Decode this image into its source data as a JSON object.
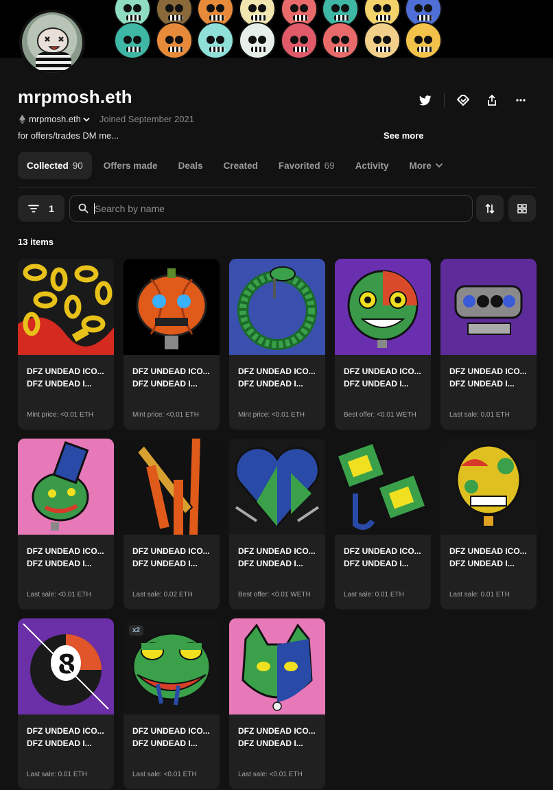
{
  "banner": {
    "skull_colors": [
      "#8fdcc0",
      "#8a6a3a",
      "#e78a3a",
      "#f2e6b0",
      "#e96a6a",
      "#3fb7a5",
      "#f3d36a",
      "#4f6fd6",
      "#3fb7a5",
      "#e78a3a",
      "#8fe0d8",
      "#e6f0e8",
      "#e05a6a",
      "#e96a6a",
      "#f2d08a",
      "#f3c24a"
    ]
  },
  "profile": {
    "name": "mrpmosh.eth",
    "wallet": "mrpmosh.eth",
    "joined": "Joined September 2021",
    "bio": "for offers/trades DM me...",
    "see_more": "See more"
  },
  "actions": [
    "twitter-icon",
    "offers-icon",
    "share-icon",
    "more-icon"
  ],
  "tabs": [
    {
      "label": "Collected",
      "count": "90",
      "active": true
    },
    {
      "label": "Offers made",
      "count": ""
    },
    {
      "label": "Deals",
      "count": ""
    },
    {
      "label": "Created",
      "count": ""
    },
    {
      "label": "Favorited",
      "count": "69"
    },
    {
      "label": "Activity",
      "count": ""
    },
    {
      "label": "More",
      "count": ""
    }
  ],
  "filter": {
    "count": "1"
  },
  "search": {
    "placeholder": "Search by name"
  },
  "items_count": "13 items",
  "items": [
    {
      "title": "DFZ UNDEAD ICO...",
      "subtitle": "DFZ UNDEAD I...",
      "price": "Mint price: <0.01 ETH",
      "bg": "#1a1a1a",
      "art": "chains"
    },
    {
      "title": "DFZ UNDEAD ICO...",
      "subtitle": "DFZ UNDEAD I...",
      "price": "Mint price: <0.01 ETH",
      "bg": "#000000",
      "art": "pumpkin"
    },
    {
      "title": "DFZ UNDEAD ICO...",
      "subtitle": "DFZ UNDEAD I...",
      "price": "Mint price: <0.01 ETH",
      "bg": "#3a4fae",
      "art": "snake"
    },
    {
      "title": "DFZ UNDEAD ICO...",
      "subtitle": "DFZ UNDEAD I...",
      "price": "Best offer: <0.01 WETH",
      "bg": "#6a2fae",
      "art": "zombie"
    },
    {
      "title": "DFZ UNDEAD ICO...",
      "subtitle": "DFZ UNDEAD I...",
      "price": "Last sale: 0.01 ETH",
      "bg": "#5e2b9a",
      "art": "knuckles"
    },
    {
      "title": "DFZ UNDEAD ICO...",
      "subtitle": "DFZ UNDEAD I...",
      "price": "Last sale: <0.01 ETH",
      "bg": "#e879b8",
      "art": "mouse"
    },
    {
      "title": "DFZ UNDEAD ICO...",
      "subtitle": "DFZ UNDEAD I...",
      "price": "Last sale: 0.02 ETH",
      "bg": "#111111",
      "art": "dagger"
    },
    {
      "title": "DFZ UNDEAD ICO...",
      "subtitle": "DFZ UNDEAD I...",
      "price": "Best offer: <0.01 WETH",
      "bg": "#181818",
      "art": "heart"
    },
    {
      "title": "DFZ UNDEAD ICO...",
      "subtitle": "DFZ UNDEAD I...",
      "price": "Last sale: 0.01 ETH",
      "bg": "#121212",
      "art": "glasses"
    },
    {
      "title": "DFZ UNDEAD ICO...",
      "subtitle": "DFZ UNDEAD I...",
      "price": "Last sale: 0.01 ETH",
      "bg": "#151515",
      "art": "balloon"
    },
    {
      "title": "DFZ UNDEAD ICO...",
      "subtitle": "DFZ UNDEAD I...",
      "price": "Last sale: 0.01 ETH",
      "bg": "#6b2fa8",
      "art": "eightball"
    },
    {
      "title": "DFZ UNDEAD ICO...",
      "subtitle": "DFZ UNDEAD I...",
      "price": "Last sale: <0.01 ETH",
      "bg": "#141414",
      "art": "frog",
      "badge": "x2"
    },
    {
      "title": "DFZ UNDEAD ICO...",
      "subtitle": "DFZ UNDEAD I...",
      "price": "Last sale: <0.01 ETH",
      "bg": "#e879b8",
      "art": "cat"
    }
  ]
}
